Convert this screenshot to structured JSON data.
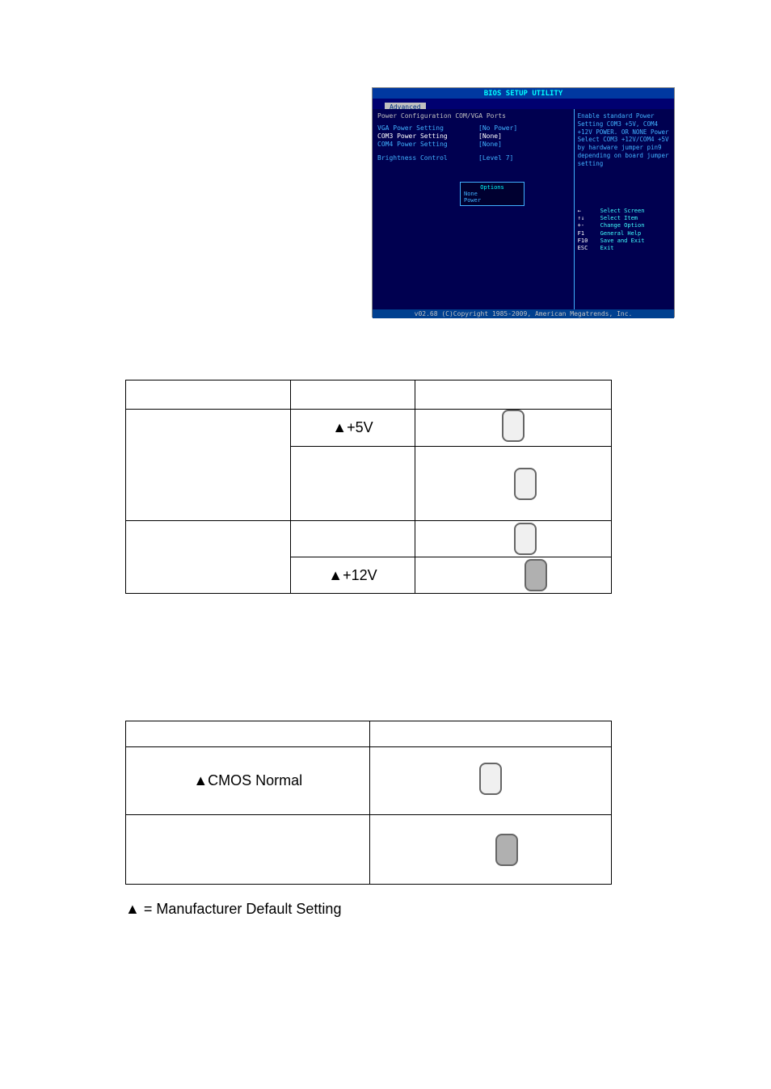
{
  "bios": {
    "header": "BIOS SETUP UTILITY",
    "tab": "Advanced",
    "leftTitle": "Power Configuration COM/VGA Ports",
    "settings": [
      {
        "name": "VGA Power Setting",
        "value": "[No Power]",
        "selected": false
      },
      {
        "name": "COM3 Power Setting",
        "value": "[None]",
        "selected": true
      },
      {
        "name": "COM4 Power Setting",
        "value": "[None]",
        "selected": false
      },
      {
        "name": "Brightness Control",
        "value": "[Level 7]",
        "selected": false
      }
    ],
    "optionsBox": {
      "title": "Options",
      "items": [
        "None",
        "Power"
      ]
    },
    "helpText": "Enable standard Power Setting COM3 +5V, COM4 +12V POWER. OR NONE Power Select COM3 +12V/COM4 +5V by hardware jumper pin9 depending on board jumper setting",
    "nav": [
      {
        "key": "←",
        "desc": "Select Screen"
      },
      {
        "key": "↑↓",
        "desc": "Select Item"
      },
      {
        "key": "+-",
        "desc": "Change Option"
      },
      {
        "key": "F1",
        "desc": "General Help"
      },
      {
        "key": "F10",
        "desc": "Save and Exit"
      },
      {
        "key": "ESC",
        "desc": "Exit"
      }
    ],
    "footer": "v02.68 (C)Copyright 1985-2009, American Megatrends, Inc."
  },
  "table1": {
    "rows": [
      {
        "c1": "▲+5V"
      },
      {
        "c1": ""
      },
      {
        "c1": ""
      },
      {
        "c1": "▲+12V"
      }
    ]
  },
  "table2": {
    "rows": [
      {
        "c0": "▲CMOS Normal"
      },
      {
        "c0": ""
      }
    ]
  },
  "footnote": "▲ = Manufacturer Default Setting"
}
